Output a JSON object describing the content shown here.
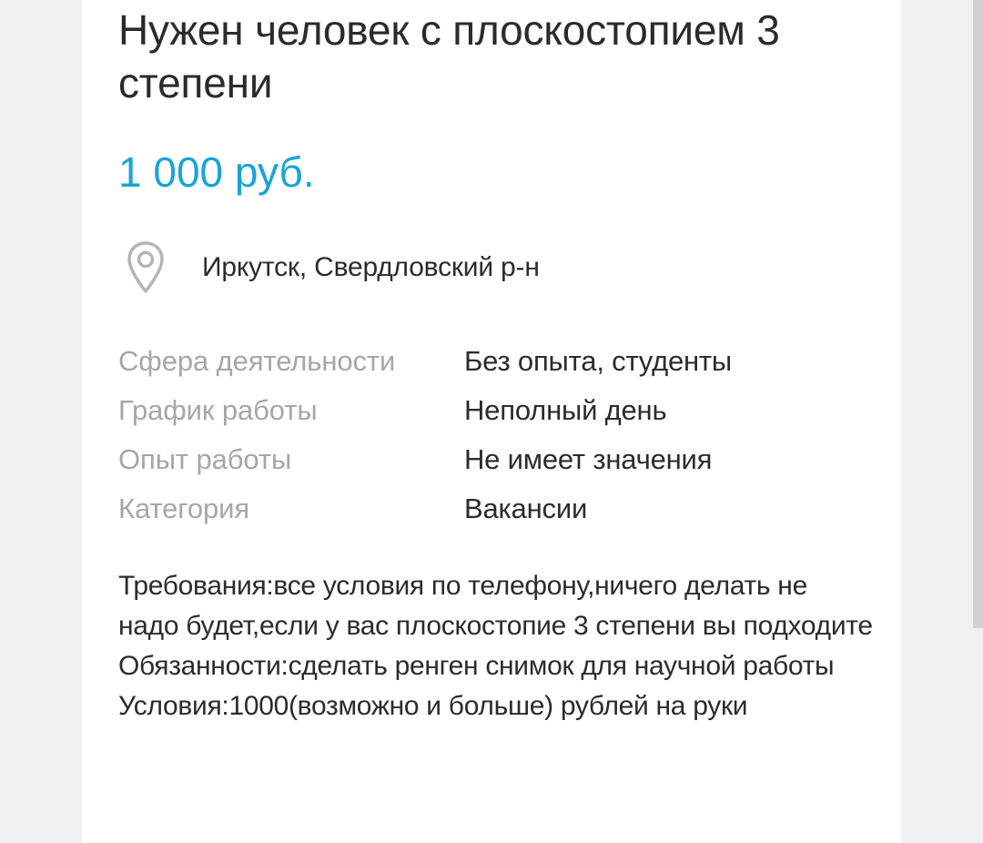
{
  "listing": {
    "title": "Нужен человек с плоскостопием 3 степени",
    "price": "1 000 руб.",
    "location": "Иркутск, Свердловский р-н",
    "details": [
      {
        "label": "Сфера деятельности",
        "value": "Без опыта, студенты"
      },
      {
        "label": "График работы",
        "value": "Неполный день"
      },
      {
        "label": "Опыт работы",
        "value": "Не имеет значения"
      },
      {
        "label": "Категория",
        "value": "Вакансии"
      }
    ],
    "description": {
      "requirements": "Требования:все условия по телефону,ничего делать не надо будет,если у вас плоскостопие 3 степени вы подходите",
      "duties": "Обязанности:сделать ренген снимок для научной работы",
      "conditions": "Условия:1000(возможно и больше) рублей на руки"
    }
  },
  "icons": {
    "location": "location-pin-icon"
  },
  "colors": {
    "price": "#1aa3d8",
    "label": "#a6a6a6",
    "text": "#2b2b2b",
    "background": "#eef0f2"
  }
}
